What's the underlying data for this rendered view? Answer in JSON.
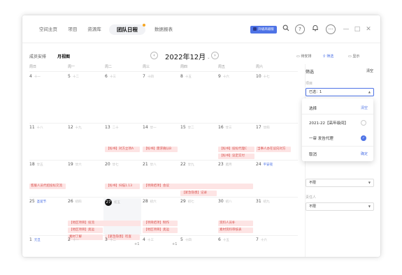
{
  "nav": {
    "tabs": [
      "空间主页",
      "项目",
      "资源库",
      "团队日程",
      "数据报表"
    ],
    "active_index": 3,
    "vip_label": "升级高级版",
    "accent": "#4e73e6"
  },
  "toolbar": {
    "search_icon": "search-icon",
    "help_glyph": "?",
    "bell_icon": "bell-icon",
    "more_glyph": "···",
    "minimize_glyph": "—",
    "maximize_glyph": "□",
    "close_glyph": "✕"
  },
  "subbar": {
    "tabs": [
      "成员安排",
      "月视图"
    ],
    "active_index": 1,
    "month": "2022年12月",
    "prev_glyph": "‹",
    "next_glyph": "›",
    "right_buttons": [
      "待安排",
      "筛选",
      "显示"
    ]
  },
  "calendar": {
    "weekdays": [
      "周日",
      "周一",
      "周二",
      "周三",
      "周四",
      "周五",
      "周六"
    ],
    "weeks": [
      [
        [
          "4",
          "十一"
        ],
        [
          "5",
          "十二"
        ],
        [
          "6",
          "十三"
        ],
        [
          "7",
          "十四"
        ],
        [
          "8",
          "十五"
        ],
        [
          "9",
          "十六"
        ],
        [
          "10",
          "十七"
        ]
      ],
      [
        [
          "11",
          "十八"
        ],
        [
          "12",
          "十九"
        ],
        [
          "13",
          "二十"
        ],
        [
          "14",
          "廿一"
        ],
        [
          "15",
          "廿二"
        ],
        [
          "16",
          "廿三"
        ],
        [
          "17",
          "廿四"
        ]
      ],
      [
        [
          "18",
          "廿五"
        ],
        [
          "19",
          "廿六"
        ],
        [
          "20",
          "廿七"
        ],
        [
          "21",
          "廿八"
        ],
        [
          "22",
          "廿九"
        ],
        [
          "23",
          "腊月"
        ],
        [
          "24",
          "平安夜"
        ]
      ],
      [
        [
          "25",
          "圣诞节"
        ],
        [
          "26",
          "初四"
        ],
        [
          "27",
          "初五"
        ],
        [
          "28",
          "初六"
        ],
        [
          "29",
          "初七"
        ],
        [
          "30",
          "初八"
        ],
        [
          "31",
          "初九"
        ]
      ],
      [
        [
          "1",
          "元旦"
        ],
        [
          "2",
          "十一"
        ],
        [
          "3",
          "十二"
        ],
        [
          "4",
          "十三"
        ],
        [
          "5",
          "十四"
        ],
        [
          "6",
          "十五"
        ],
        [
          "7",
          "十六"
        ]
      ]
    ],
    "holiday_labels": [
      "平安夜",
      "圣诞节",
      "元旦"
    ],
    "today": "27",
    "events": [
      "【标书】对方立项A",
      "【标书】需求确认B",
      "【标书】投标代理C",
      "当事人办在议向对方",
      "【标书】议定实付",
      "客服人员代招投标交流",
      "【标书】扫描1.13",
      "【项目结项】会议",
      "【紧急隐患】记录",
      "【地区项目】投流",
      "【地区项目】奥运",
      "【紧急隐患】检查",
      "【项目结项】制作",
      "【地区项目】奥运",
      "资料人员补",
      "素材了解",
      "素材资料审核表"
    ],
    "more_labels": [
      "+1",
      "+1"
    ]
  },
  "filter": {
    "title": "筛选",
    "reset": "清空",
    "project_label": "项目",
    "project_value": "已选：1",
    "select_value_1": "不限",
    "owner_label": "责任人",
    "owner_value": "不限"
  },
  "dropdown": {
    "header": "选择",
    "header_action": "清空",
    "options": [
      "2021-22【高年级间】",
      "一审 发告代理"
    ],
    "selected_index": 1,
    "cancel": "取消",
    "confirm": "确定"
  }
}
